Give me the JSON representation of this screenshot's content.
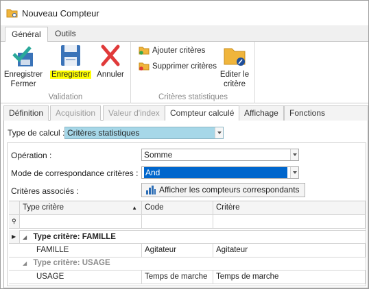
{
  "window": {
    "title": "Nouveau Compteur"
  },
  "ribbon_tabs": [
    "Général",
    "Outils"
  ],
  "ribbon": {
    "save_close_label": "Enregistrer Fermer",
    "save_label": "Enregistrer",
    "cancel_label": "Annuler",
    "validation_group": "Validation",
    "add_criteria": "Ajouter critères",
    "remove_criteria": "Supprimer critères",
    "edit_criteria": "Editer le critère",
    "stats_group": "Critères statistiques"
  },
  "content_tabs": [
    "Définition",
    "Acquisition",
    "Valeur d'index",
    "Compteur calculé",
    "Affichage",
    "Fonctions associées"
  ],
  "form": {
    "calc_type_label": "Type de calcul :",
    "calc_type_value": "Critères statistiques",
    "operation_label": "Opération :",
    "operation_value": "Somme",
    "match_mode_label": "Mode de correspondance critères :",
    "match_mode_value": "And",
    "associated_label": "Critères associés :",
    "show_counters_button": "Afficher les compteurs correspondants"
  },
  "grid": {
    "columns": [
      "Type critère",
      "Code",
      "Critère"
    ],
    "groups": [
      {
        "title": "Type critère: FAMILLE",
        "rows": [
          {
            "type": "FAMILLE",
            "code": "Agitateur",
            "critere": "Agitateur"
          }
        ]
      },
      {
        "title": "Type critère: USAGE",
        "rows": [
          {
            "type": "USAGE",
            "code": "Temps de marche",
            "critere": "Temps de marche"
          }
        ]
      }
    ]
  },
  "colors": {
    "accent_teal": "#a6d7e8",
    "selection_blue": "#0066cc",
    "highlight_yellow": "#ffff00",
    "folder_yellow": "#f0b53c",
    "check_green": "#2aa89a",
    "disk_blue": "#3a73b8",
    "cancel_red": "#e03a3a"
  }
}
